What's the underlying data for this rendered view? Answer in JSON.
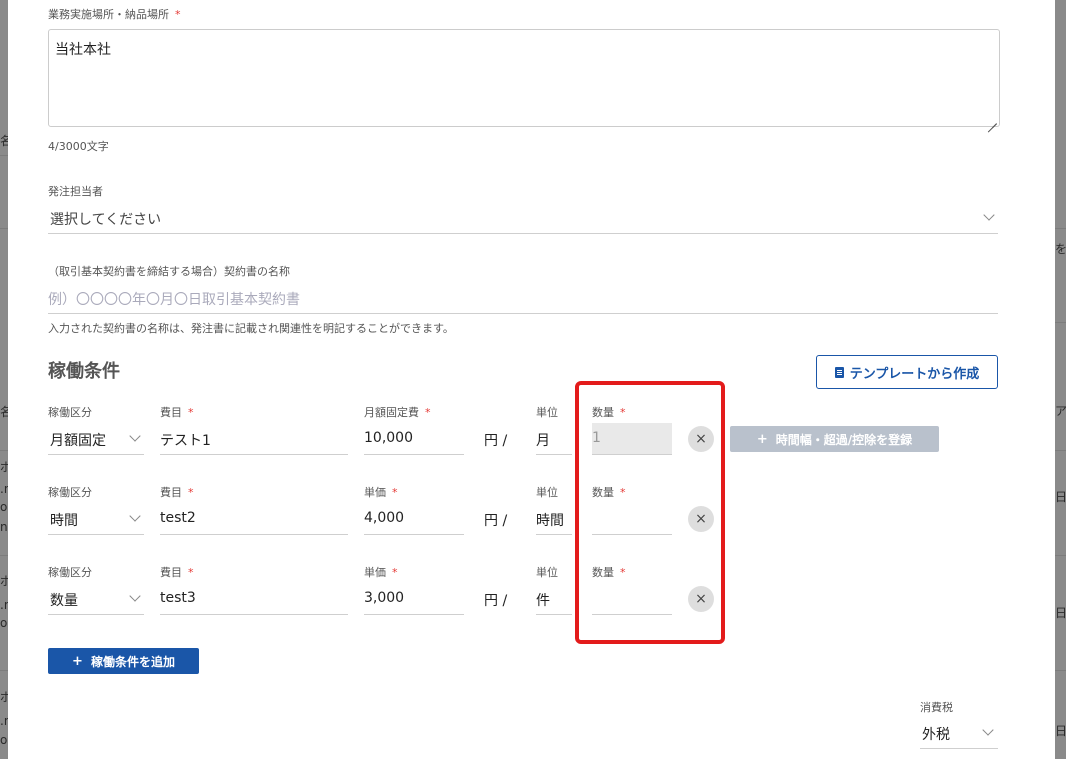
{
  "background": {
    "left_fragments": [
      "名",
      "名",
      "ポ",
      ".n",
      "ou",
      "n",
      "ポ",
      ".n",
      "ou",
      "ポ",
      ".n",
      "ou"
    ],
    "right_fragments": [
      "を",
      "ア前",
      "日前",
      "日前",
      "日前"
    ]
  },
  "delivery": {
    "label": "業務実施場所・納品場所",
    "required_mark": "*",
    "value": "当社本社",
    "char_count": "4/3000文字"
  },
  "ordering_person": {
    "label": "発注担当者",
    "placeholder": "選択してください"
  },
  "contract_name": {
    "label": "（取引基本契約書を締結する場合）契約書の名称",
    "placeholder": "例）〇〇〇〇年〇月〇日取引基本契約書",
    "helper": "入力された契約書の名称は、発注書に記載され関連性を明記することができます。"
  },
  "conditions": {
    "section_title": "稼働条件",
    "template_button": "テンプレートから作成",
    "rows": [
      {
        "type_label": "稼働区分",
        "type_value": "月額固定",
        "item_label": "費目",
        "item_value": "テスト1",
        "price_label": "月額固定費",
        "price_value": "10,000",
        "currency": "円 /",
        "unit_label": "単位",
        "unit_value": "月",
        "qty_label": "数量",
        "qty_value": "1"
      },
      {
        "type_label": "稼働区分",
        "type_value": "時間",
        "item_label": "費目",
        "item_value": "test2",
        "price_label": "単価",
        "price_value": "4,000",
        "currency": "円 /",
        "unit_label": "単位",
        "unit_value": "時間",
        "qty_label": "数量",
        "qty_value": ""
      },
      {
        "type_label": "稼働区分",
        "type_value": "数量",
        "item_label": "費目",
        "item_value": "test3",
        "price_label": "単価",
        "price_value": "3,000",
        "currency": "円 /",
        "unit_label": "単位",
        "unit_value": "件",
        "qty_label": "数量",
        "qty_value": ""
      }
    ],
    "register_time_button": "時間幅・超過/控除を登録",
    "add_condition_button": "稼働条件を追加",
    "remove_symbol": "×",
    "plus_symbol": "+"
  },
  "tax": {
    "label": "消費税",
    "value": "外税"
  },
  "colors": {
    "primary": "#1a56a8",
    "required": "#e53935",
    "highlight": "#e31b1b"
  }
}
